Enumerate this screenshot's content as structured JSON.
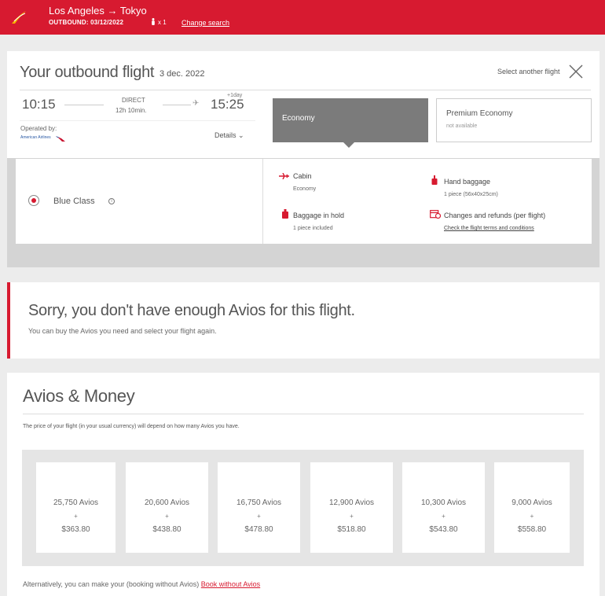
{
  "header": {
    "route": "Los Angeles → Tokyo",
    "outbound": "OUTBOUND: 03/12/2022",
    "passengers": "x 1",
    "change_search": "Change search",
    "brand_color": "#d71a30"
  },
  "flight": {
    "title": "Your outbound flight",
    "date": "3 dec. 2022",
    "select_another": "Select another flight",
    "departure_time": "10:15",
    "arrival_time": "15:25",
    "plus_day": "+1day",
    "stops": "DIRECT",
    "duration": "12h 10min.",
    "operated_by": "Operated by:",
    "airline": "American Airlines",
    "details": "Details ⌄"
  },
  "cabins": {
    "economy": "Economy",
    "premium": "Premium Economy",
    "premium_status": "not available"
  },
  "fare": {
    "name": "Blue Class",
    "info_icon": "ⓘ",
    "features": {
      "cabin_label": "Cabin",
      "cabin_value": "Economy",
      "hand_label": "Hand baggage",
      "hand_value": "1 piece (56x40x25cm)",
      "hold_label": "Baggage in hold",
      "hold_value": "1 piece included",
      "changes_label": "Changes and refunds (per flight)",
      "changes_link": "Check the flight terms and conditions"
    }
  },
  "notice": {
    "title": "Sorry, you don't have enough Avios for this flight.",
    "subtitle": "You can buy the Avios you need and select your flight again."
  },
  "avios_money": {
    "title": "Avios & Money",
    "description": "The price of your flight (in your usual currency) will depend on how many Avios you have.",
    "options": [
      {
        "avios": "25,750 Avios",
        "plus": "+",
        "money": "$363.80"
      },
      {
        "avios": "20,600 Avios",
        "plus": "+",
        "money": "$438.80"
      },
      {
        "avios": "16,750 Avios",
        "plus": "+",
        "money": "$478.80"
      },
      {
        "avios": "12,900 Avios",
        "plus": "+",
        "money": "$518.80"
      },
      {
        "avios": "10,300 Avios",
        "plus": "+",
        "money": "$543.80"
      },
      {
        "avios": "9,000 Avios",
        "plus": "+",
        "money": "$558.80"
      }
    ],
    "alternative_text": "Alternatively, you can make your (booking without Avios)",
    "alternative_link": "Book without Avios"
  }
}
